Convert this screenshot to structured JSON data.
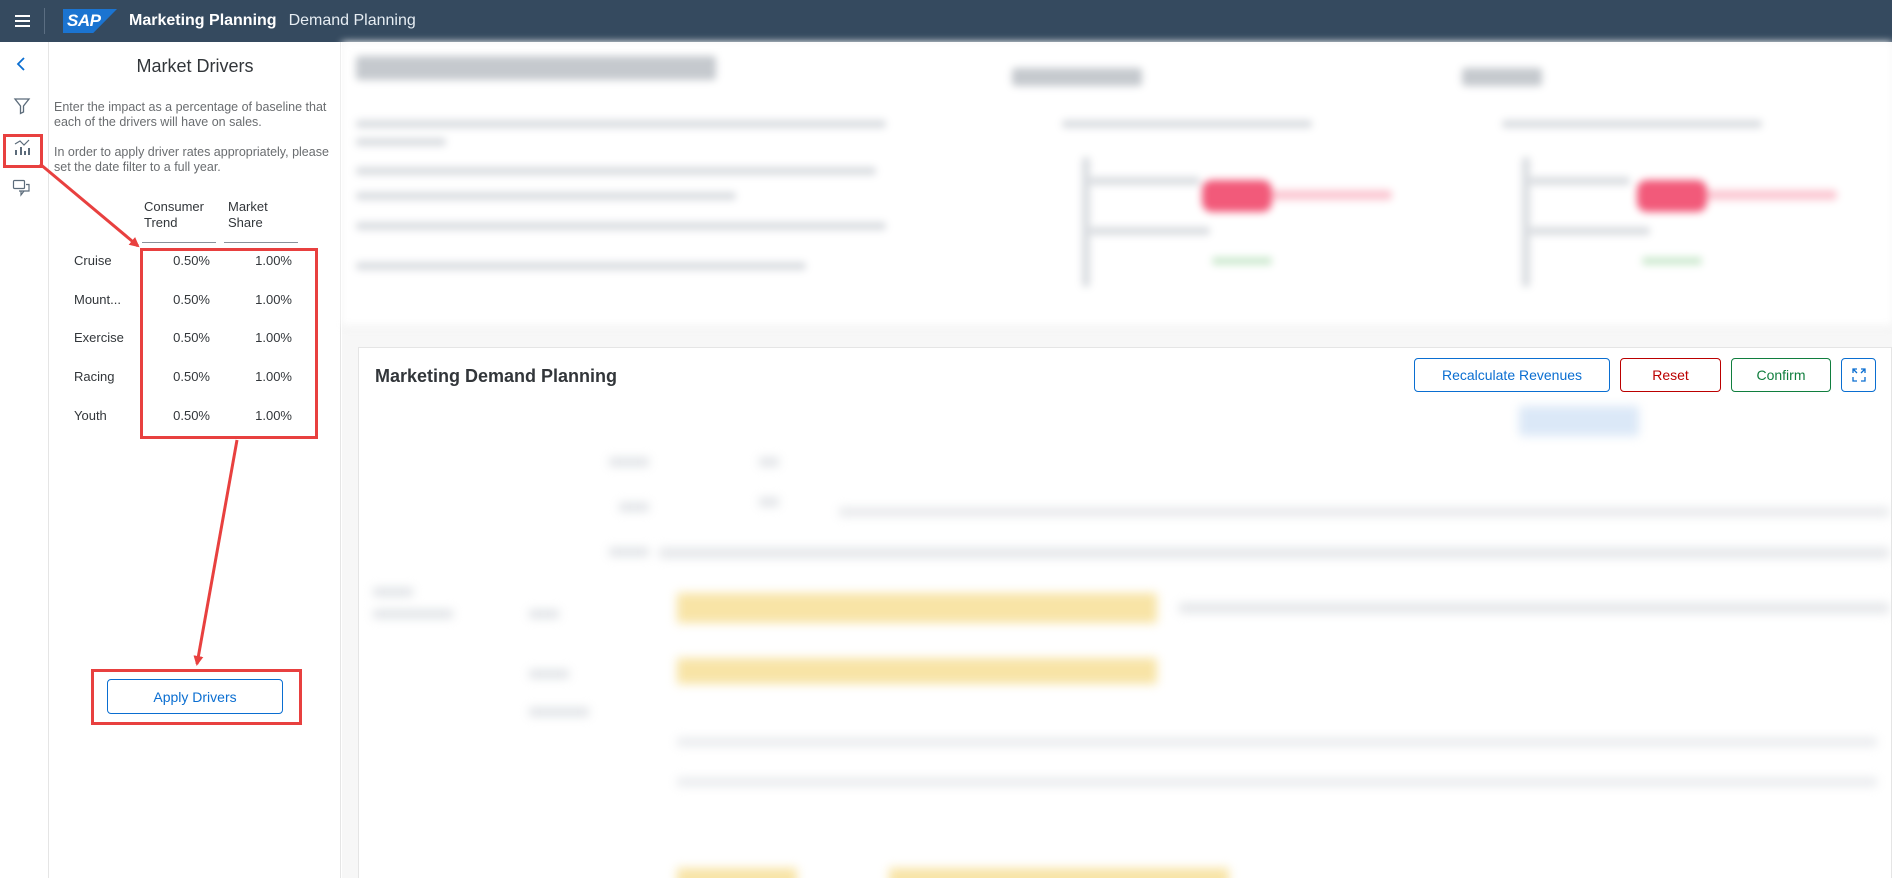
{
  "shell": {
    "logo": "SAP",
    "title": "Marketing Planning",
    "subtitle": "Demand Planning"
  },
  "icon_strip": [
    "back-icon",
    "filter-icon",
    "chart-icon",
    "comments-icon"
  ],
  "panel": {
    "title": "Market Drivers",
    "description1": "Enter the impact as a percentage of baseline that each of the drivers will have on sales.",
    "description2": "In order to apply driver rates appropriately, please set the date filter to a full year.",
    "columns": [
      "Consumer Trend",
      "Market Share"
    ],
    "rows": [
      {
        "label": "Cruise",
        "consumer_trend": "0.50%",
        "market_share": "1.00%"
      },
      {
        "label": "Mount...",
        "consumer_trend": "0.50%",
        "market_share": "1.00%"
      },
      {
        "label": "Exercise",
        "consumer_trend": "0.50%",
        "market_share": "1.00%"
      },
      {
        "label": "Racing",
        "consumer_trend": "0.50%",
        "market_share": "1.00%"
      },
      {
        "label": "Youth",
        "consumer_trend": "0.50%",
        "market_share": "1.00%"
      }
    ],
    "apply_label": "Apply Drivers"
  },
  "main": {
    "card_title": "Marketing Demand Planning",
    "buttons": {
      "recalculate": "Recalculate Revenues",
      "reset": "Reset",
      "confirm": "Confirm"
    }
  },
  "colors": {
    "shellbar": "#354a5f",
    "accent": "#0a6ed1",
    "reset": "#bb0000",
    "confirm": "#107e3e",
    "highlight": "#e8403f"
  }
}
